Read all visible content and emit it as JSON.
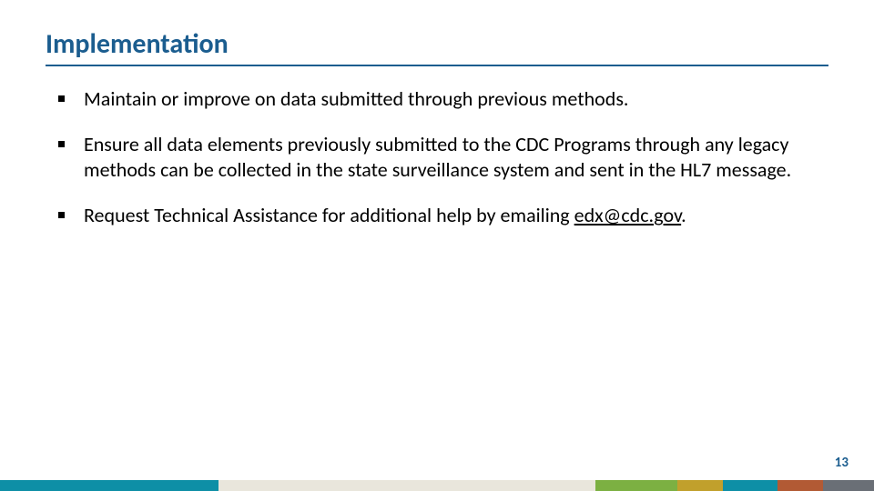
{
  "slide": {
    "title": "Implementation",
    "bullets": [
      {
        "text": "Maintain or improve on data submitted through previous methods."
      },
      {
        "text": "Ensure all data elements previously submitted to the CDC Programs through any legacy methods can be collected in the state surveillance system and sent in the HL7 message."
      },
      {
        "text_prefix": "Request Technical Assistance for additional help by emailing ",
        "email": "edx@cdc.gov",
        "text_suffix": "."
      }
    ],
    "page_number": "13"
  }
}
